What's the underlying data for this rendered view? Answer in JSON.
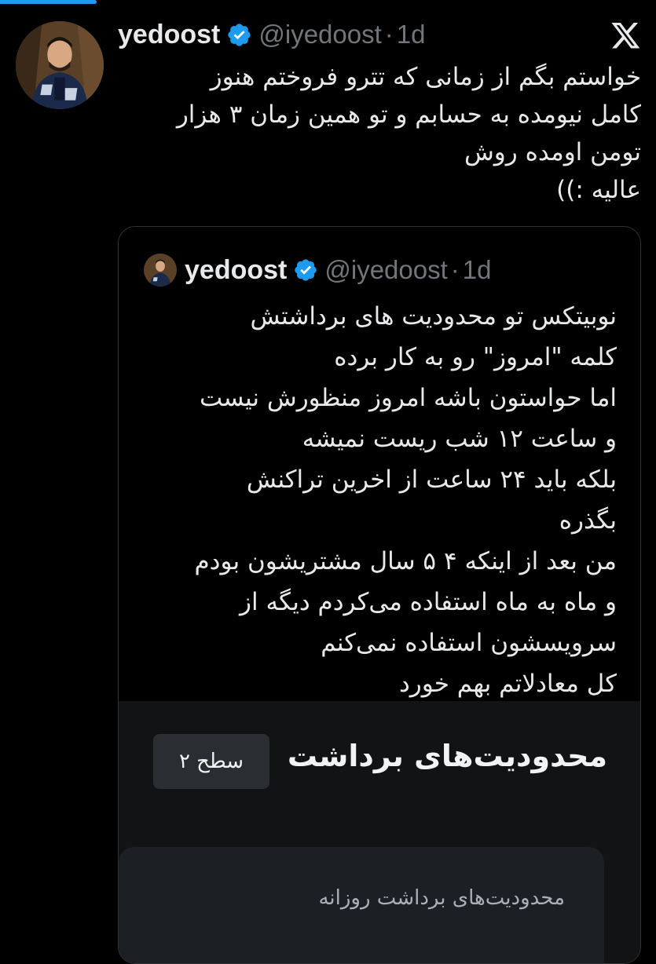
{
  "tweet": {
    "display_name": "yedoost",
    "handle": "@iyedoost",
    "separator": "·",
    "time": "1d",
    "lines": [
      "خواستم بگم از زمانی که تترو فروختم هنوز",
      "کامل نیومده به حسابم و تو همین زمان ۳ هزار",
      "تومن اومده روش",
      "عالیه :))"
    ]
  },
  "quoted_tweet": {
    "display_name": "yedoost",
    "handle": "@iyedoost",
    "separator": "·",
    "time": "1d",
    "lines": [
      "نوبیتکس تو محدودیت های برداشتش",
      "کلمه \"امروز\" رو به کار برده",
      "اما حواستون باشه امروز منظورش نیست",
      "و ساعت ۱۲ شب ریست نمیشه",
      "بلکه باید ۲۴ ساعت از اخرین تراکنش",
      "بگذره",
      "من بعد از اینکه ۴ ۵ سال مشتریشون بودم",
      "و ماه به ماه استفاده می‌کردم دیگه از",
      "سرویسشون استفاده نمی‌کنم",
      "کل معادلاتم بهم خورد"
    ]
  },
  "embedded_image": {
    "title": "محدودیت‌های برداشت",
    "level_badge": "سطح ۲",
    "daily_limits_label": "محدودیت‌های برداشت روزانه"
  },
  "icons": {
    "verified": "verified-badge-icon",
    "platform_logo": "x-logo-icon"
  },
  "colors": {
    "background": "#000000",
    "text_primary": "#e7e9ea",
    "text_secondary": "#71767b",
    "accent": "#1d9bf0",
    "border": "#2f3336"
  }
}
